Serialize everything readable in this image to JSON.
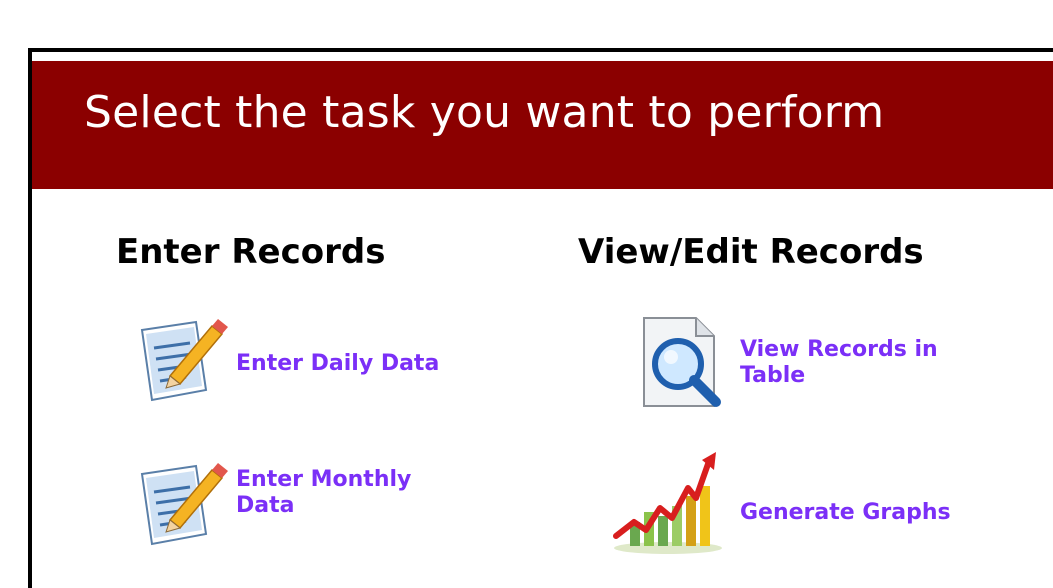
{
  "header": {
    "title": "Select the task you want to perform"
  },
  "sections": {
    "enter": {
      "heading": "Enter Records",
      "tasks": [
        {
          "label": "Enter Daily Data",
          "icon": "edit-document-icon"
        },
        {
          "label": "Enter Monthly Data",
          "icon": "edit-document-icon"
        }
      ]
    },
    "view": {
      "heading": "View/Edit Records",
      "tasks": [
        {
          "label": "View Records in Table",
          "icon": "magnifier-document-icon"
        },
        {
          "label": "Generate Graphs",
          "icon": "growth-chart-icon"
        }
      ]
    }
  },
  "colors": {
    "header_bg": "#8b0000",
    "link": "#7b2ff7"
  }
}
